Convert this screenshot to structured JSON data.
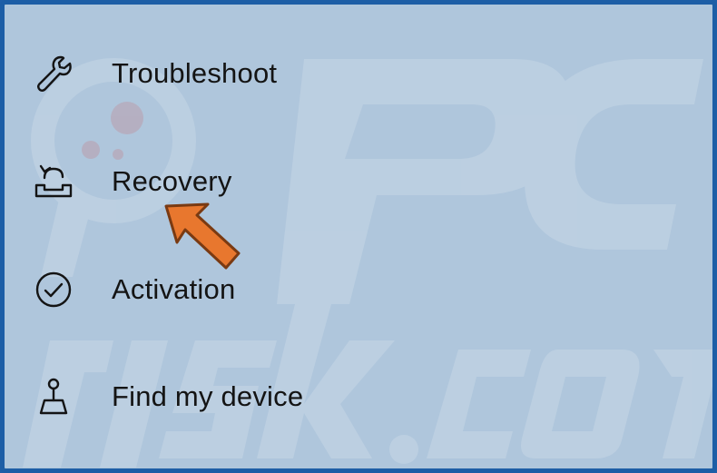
{
  "menu": {
    "items": [
      {
        "label": "Troubleshoot",
        "icon": "wrench-icon"
      },
      {
        "label": "Recovery",
        "icon": "recovery-icon"
      },
      {
        "label": "Activation",
        "icon": "check-circle-icon"
      },
      {
        "label": "Find my device",
        "icon": "find-device-icon"
      }
    ]
  },
  "annotation": {
    "arrow_color": "#e8772e",
    "arrow_target": "Recovery"
  },
  "theme": {
    "background": "#afc6dc",
    "border": "#1d5ea6",
    "text": "#141414"
  }
}
